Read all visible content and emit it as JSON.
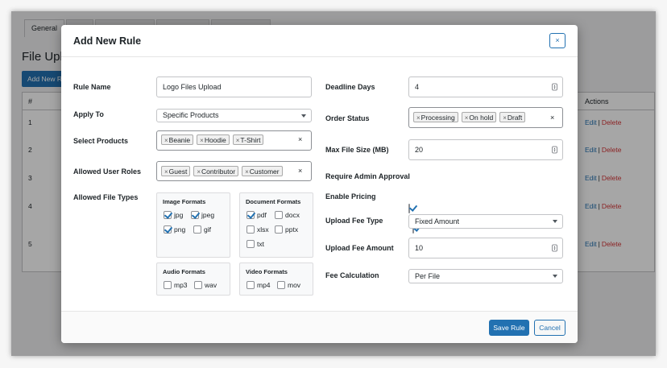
{
  "background": {
    "tabs": [
      "General",
      "",
      "",
      "",
      ""
    ],
    "page_title": "File Upl",
    "add_button": "Add New R",
    "table": {
      "col_num": "#",
      "col_actions": "Actions",
      "rows": [
        {
          "num": "1",
          "edit": "Edit",
          "sep": "|",
          "delete": "Delete"
        },
        {
          "num": "2",
          "edit": "Edit",
          "sep": "|",
          "delete": "Delete"
        },
        {
          "num": "3",
          "edit": "Edit",
          "sep": "|",
          "delete": "Delete"
        },
        {
          "num": "4",
          "edit": "Edit",
          "sep": "|",
          "delete": "Delete"
        },
        {
          "num": "5",
          "edit": "Edit",
          "sep": "|",
          "delete": "Delete"
        }
      ]
    }
  },
  "modal": {
    "title": "Add New Rule",
    "close_label": "×",
    "left": {
      "rule_name": {
        "label": "Rule Name",
        "value": "Logo Files Upload"
      },
      "apply_to": {
        "label": "Apply To",
        "value": "Specific Products"
      },
      "select_products": {
        "label": "Select Products",
        "tags": [
          "Beanie",
          "Hoodie",
          "T-Shirt"
        ],
        "clear": "×"
      },
      "allowed_roles": {
        "label": "Allowed User Roles",
        "tags": [
          "Guest",
          "Contributor",
          "Customer"
        ],
        "clear": "×"
      },
      "file_types": {
        "label": "Allowed File Types",
        "image": {
          "title": "Image Formats",
          "options": [
            {
              "label": "jpg",
              "checked": true
            },
            {
              "label": "jpeg",
              "checked": true
            },
            {
              "label": "png",
              "checked": true
            },
            {
              "label": "gif",
              "checked": false
            }
          ]
        },
        "document": {
          "title": "Document Formats",
          "options": [
            {
              "label": "pdf",
              "checked": true
            },
            {
              "label": "docx",
              "checked": false
            },
            {
              "label": "xlsx",
              "checked": false
            },
            {
              "label": "pptx",
              "checked": false
            },
            {
              "label": "txt",
              "checked": false
            }
          ]
        },
        "audio": {
          "title": "Audio Formats",
          "options": [
            {
              "label": "mp3",
              "checked": false
            },
            {
              "label": "wav",
              "checked": false
            }
          ]
        },
        "video": {
          "title": "Video Formats",
          "options": [
            {
              "label": "mp4",
              "checked": false
            },
            {
              "label": "mov",
              "checked": false
            }
          ]
        }
      }
    },
    "right": {
      "deadline_days": {
        "label": "Deadline Days",
        "value": "4"
      },
      "order_status": {
        "label": "Order Status",
        "tags": [
          "Processing",
          "On hold",
          "Draft"
        ],
        "clear": "×"
      },
      "max_file_size": {
        "label": "Max File Size (MB)",
        "value": "20"
      },
      "require_approval": {
        "label": "Require Admin Approval",
        "checked": true
      },
      "enable_pricing": {
        "label": "Enable Pricing",
        "checked": true
      },
      "upload_fee_type": {
        "label": "Upload Fee Type",
        "value": "Fixed Amount"
      },
      "upload_fee_amount": {
        "label": "Upload Fee Amount",
        "value": "10"
      },
      "fee_calculation": {
        "label": "Fee Calculation",
        "value": "Per File"
      }
    },
    "footer": {
      "save": "Save Rule",
      "cancel": "Cancel"
    }
  },
  "colors": {
    "primary": "#2271b1",
    "danger": "#d63638"
  }
}
